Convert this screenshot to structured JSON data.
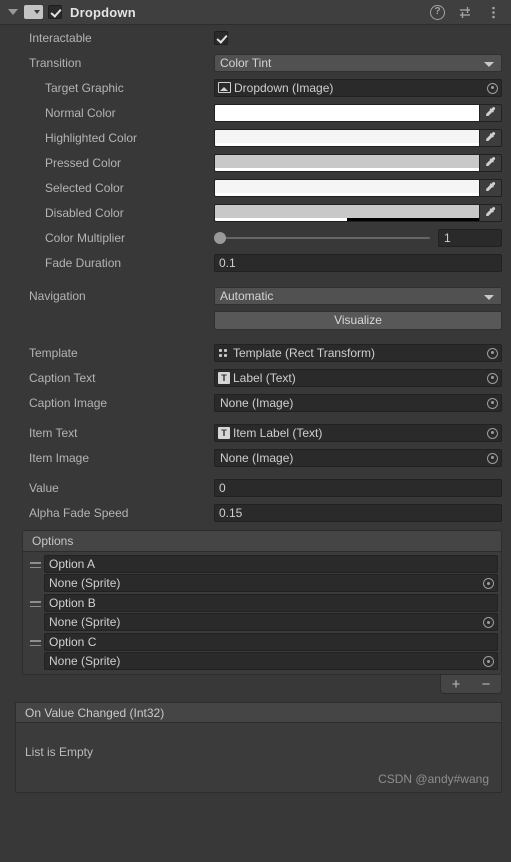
{
  "header": {
    "title": "Dropdown",
    "foldout_icon": "triangle-down-icon",
    "component_icon": "dropdown-component-icon",
    "enabled": true,
    "help_icon": "?",
    "preset_icon": "preset-icon",
    "menu_icon": "kebab-menu-icon"
  },
  "fields": {
    "interactable": {
      "label": "Interactable",
      "checked": true
    },
    "transition": {
      "label": "Transition",
      "value": "Color Tint"
    },
    "target_graphic": {
      "label": "Target Graphic",
      "value": "Dropdown (Image)",
      "icon": "image-icon"
    },
    "normal_color": {
      "label": "Normal Color",
      "color": "#FFFFFF",
      "alpha": 100
    },
    "highlighted_color": {
      "label": "Highlighted Color",
      "color": "#F5F5F5",
      "alpha": 100
    },
    "pressed_color": {
      "label": "Pressed Color",
      "color": "#C8C8C8",
      "alpha": 100
    },
    "selected_color": {
      "label": "Selected Color",
      "color": "#F5F5F5",
      "alpha": 100
    },
    "disabled_color": {
      "label": "Disabled Color",
      "color": "#C8C8C8",
      "alpha": 50
    },
    "color_multiplier": {
      "label": "Color Multiplier",
      "value": "1",
      "slider_percent": 0
    },
    "fade_duration": {
      "label": "Fade Duration",
      "value": "0.1"
    },
    "navigation": {
      "label": "Navigation",
      "value": "Automatic"
    },
    "visualize": {
      "label": "Visualize"
    },
    "template": {
      "label": "Template",
      "value": "Template (Rect Transform)",
      "icon": "rect-transform-icon"
    },
    "caption_text": {
      "label": "Caption Text",
      "value": "Label (Text)",
      "icon": "text-icon"
    },
    "caption_image": {
      "label": "Caption Image",
      "value": "None (Image)",
      "icon": "none-icon"
    },
    "item_text": {
      "label": "Item Text",
      "value": "Item Label (Text)",
      "icon": "text-icon"
    },
    "item_image": {
      "label": "Item Image",
      "value": "None (Image)",
      "icon": "none-icon"
    },
    "value": {
      "label": "Value",
      "value": "0"
    },
    "alpha_fade_speed": {
      "label": "Alpha Fade Speed",
      "value": "0.15"
    }
  },
  "options_list": {
    "header": "Options",
    "items": [
      {
        "text": "Option A",
        "sprite": "None (Sprite)"
      },
      {
        "text": "Option B",
        "sprite": "None (Sprite)"
      },
      {
        "text": "Option C",
        "sprite": "None (Sprite)"
      }
    ],
    "add_label": "+",
    "remove_label": "−"
  },
  "event_section": {
    "header": "On Value Changed (Int32)",
    "empty_text": "List is Empty"
  },
  "watermark": "CSDN @andy#wang",
  "colors": {
    "window_bg": "#383838",
    "header_bg": "#3F3F3F",
    "field_bg": "#2A2A2A",
    "popup_bg": "#515151",
    "button_bg": "#585858",
    "box_bg": "#3B3B3B",
    "box_header_bg": "#454545",
    "text": "#B4B4B4"
  }
}
